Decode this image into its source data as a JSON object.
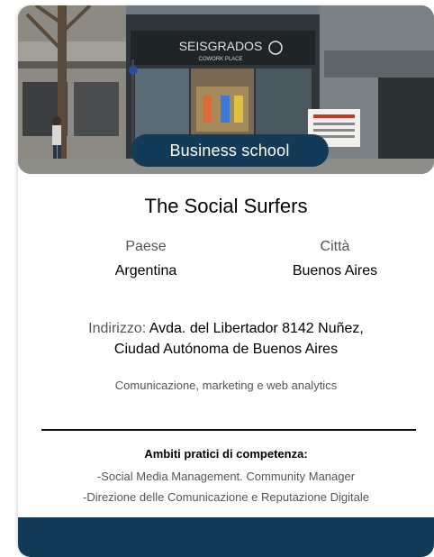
{
  "card": {
    "photo_alt": "storefront-photo",
    "sign_text": "SEISGRADOS",
    "sign_subtext": "COWORK PLACE",
    "category": "Business school",
    "name": "The Social Surfers",
    "country_label": "Paese",
    "country_value": "Argentina",
    "city_label": "Città",
    "city_value": "Buenos Aires",
    "address_label": "Indirizzo:",
    "address_line1": " Avda. del Libertador 8142 Nuñez,",
    "address_line2": "Ciudad Autónoma de Buenos Aires",
    "sector": "Comunicazione, marketing e web analytics",
    "skills_title": "Ambiti pratici di competenza:",
    "skills": [
      "-Social Media Management. Community Manager",
      "-Direzione delle Comunicazione e Reputazione Digitale"
    ]
  },
  "colors": {
    "accent": "#133a57",
    "muted_text": "#555555"
  }
}
